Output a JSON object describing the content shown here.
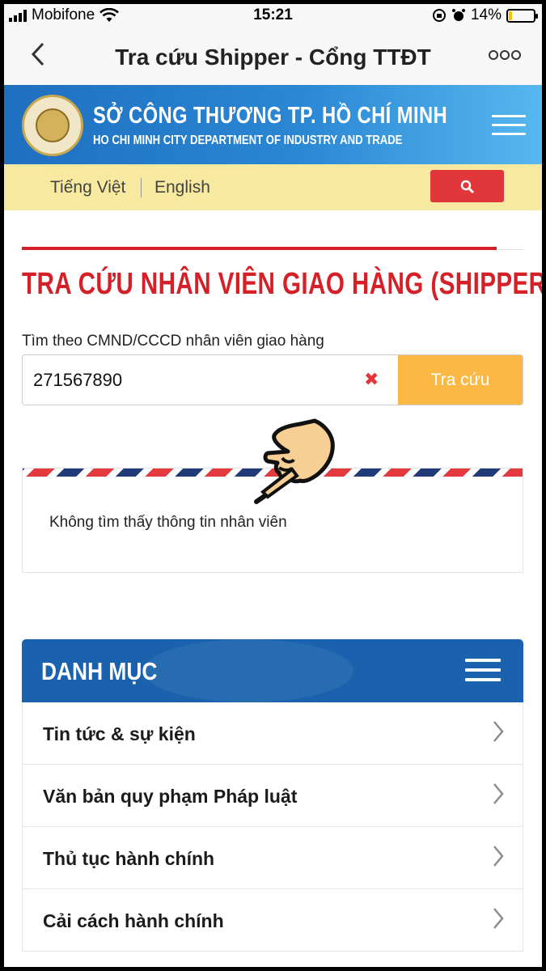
{
  "status_bar": {
    "carrier": "Mobifone",
    "time": "15:21",
    "battery": "14%",
    "battery_level": 0.14
  },
  "nav": {
    "title": "Tra cứu Shipper - Cổng TTĐT",
    "back_icon": "chevron-left-icon",
    "more_icon": "more-icon"
  },
  "site": {
    "name": "SỞ CÔNG THƯƠNG TP. HỒ CHÍ MINH",
    "subtitle": "HO CHI MINH CITY DEPARTMENT OF INDUSTRY AND TRADE"
  },
  "languages": {
    "vietnamese": "Tiếng Việt",
    "english": "English"
  },
  "page": {
    "title": "TRA CỨU NHÂN VIÊN GIAO HÀNG (SHIPPER)",
    "field_label": "Tìm theo CMND/CCCD nhân viên giao hàng",
    "input_value": "271567890",
    "clear_symbol": "✖",
    "submit_label": "Tra cứu",
    "result_text": "Không tìm thấy thông tin nhân viên"
  },
  "category": {
    "title": "DANH MỤC",
    "items": [
      {
        "label": "Tin tức & sự kiện"
      },
      {
        "label": "Văn bản quy phạm Pháp luật"
      },
      {
        "label": "Thủ tục hành chính"
      },
      {
        "label": "Cải cách hành chính"
      }
    ]
  },
  "colors": {
    "header_blue": "#1f6fc0",
    "lang_bar": "#f7e99f",
    "accent_red": "#d62027",
    "button_orange": "#fbb844",
    "category_blue": "#1a62ad"
  }
}
